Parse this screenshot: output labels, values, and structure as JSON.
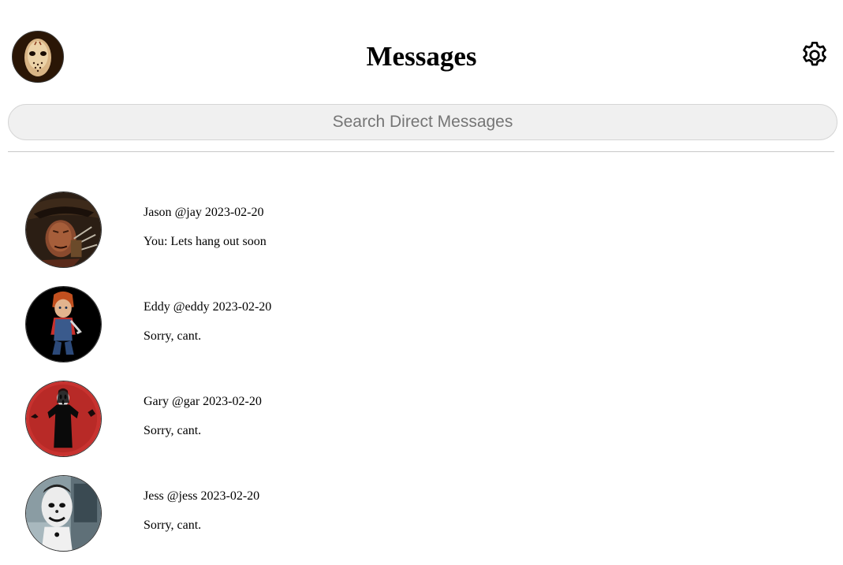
{
  "header": {
    "title": "Messages",
    "profile_avatar_icon": "hockey-mask-avatar",
    "settings_icon": "gear-icon"
  },
  "search": {
    "placeholder": "Search Direct Messages",
    "value": ""
  },
  "conversations": [
    {
      "name": "Jason",
      "handle": "@jay",
      "date": "2023-02-20",
      "preview": "You: Lets hang out soon",
      "avatar": "freddy-avatar",
      "avatar_color": "#3b2a1c"
    },
    {
      "name": "Eddy",
      "handle": "@eddy",
      "date": "2023-02-20",
      "preview": "Sorry, cant.",
      "avatar": "doll-avatar",
      "avatar_color": "#000000"
    },
    {
      "name": "Gary",
      "handle": "@gar",
      "date": "2023-02-20",
      "preview": "Sorry, cant.",
      "avatar": "ghostface-avatar",
      "avatar_color": "#c8322f"
    },
    {
      "name": "Jess",
      "handle": "@jess",
      "date": "2023-02-20",
      "preview": "Sorry, cant.",
      "avatar": "clown-avatar",
      "avatar_color": "#8a9ca3"
    }
  ]
}
